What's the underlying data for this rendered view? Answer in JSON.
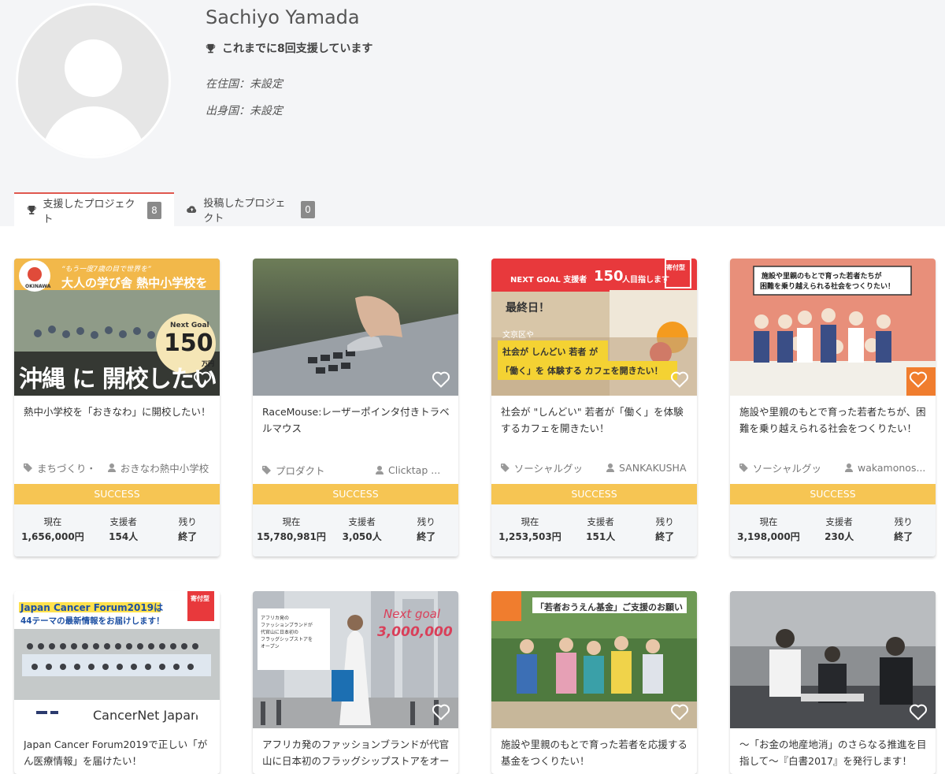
{
  "profile": {
    "name": "Sachiyo Yamada",
    "support_count": "これまでに8回支援しています",
    "residence": "在住国：未設定",
    "origin": "出身国：未設定"
  },
  "tabs": [
    {
      "label": "支援したプロジェクト",
      "count": "8"
    },
    {
      "label": "投稿したプロジェクト",
      "count": "0"
    }
  ],
  "stat_labels": {
    "current": "現在",
    "backers": "支援者",
    "remaining": "残り"
  },
  "thumb_text": {
    "c1": {
      "tagline": "“もう一度7歳の目で世界を”",
      "main": "大人の学び舎 熱中小学校を",
      "goal_label": "Next Goal",
      "goal_value": "150",
      "goal_unit": "万円",
      "banner": "沖縄 に 開校したい",
      "logo": "OKINAWA"
    },
    "c3": {
      "next": "NEXT GOAL  支援者",
      "count": "150",
      "suffix": "人目指します",
      "kifu": "寄付型",
      "last": "最終日！",
      "place": "文京区や",
      "line1": "社会が しんどい 若者 が",
      "line2": "「働く」を 体験する カフェを開きたい！"
    },
    "c4": {
      "bubble1": "施設や里親のもとで育った若者たちが",
      "bubble2": "困難を乗り越えられる社会をつくりたい！"
    },
    "c5": {
      "line1": "Japan Cancer Forum2019は",
      "line2": "44テーマの最新情報をお届けします！",
      "kifu": "寄付型",
      "brand": "CancerNet Japan"
    },
    "c6": {
      "box1": "アフリカ発の",
      "box2": "ファッションブランドが",
      "box3": "代官山に日本初の",
      "box4": "フラッグシップストアを",
      "box5": "オープン",
      "next": "Next goal",
      "amount": "3,000,000"
    },
    "c7": {
      "banner": "「若者おうえん基金」ご支援のお願い"
    }
  },
  "cards": [
    {
      "title": "熱中小学校を「おきなわ」に開校したい！",
      "category": "まちづくり・",
      "owner": "おきなわ熱中小学校",
      "status": "SUCCESS",
      "current": "1,656,000円",
      "backers": "154人",
      "remaining": "終了"
    },
    {
      "title": "RaceMouse:レーザーポインタ付きトラベルマウス",
      "category": "プロダクト",
      "owner": "Clicktap ...",
      "status": "SUCCESS",
      "current": "15,780,981円",
      "backers": "3,050人",
      "remaining": "終了"
    },
    {
      "title": "社会が \"しんどい\" 若者が「働く」を体験するカフェを開きたい！",
      "category": "ソーシャルグッ",
      "owner": "SANKAKUSHA",
      "status": "SUCCESS",
      "current": "1,253,503円",
      "backers": "151人",
      "remaining": "終了"
    },
    {
      "title": "施設や里親のもとで育った若者たちが、困難を乗り越えられる社会をつくりたい！",
      "category": "ソーシャルグッ",
      "owner": "wakamonos...",
      "status": "SUCCESS",
      "current": "3,198,000円",
      "backers": "230人",
      "remaining": "終了"
    },
    {
      "title": "Japan Cancer Forum2019で正しい「がん医療情報」を届けたい！"
    },
    {
      "title": "アフリカ発のファッションブランドが代官山に日本初のフラッグシップストアをオープン"
    },
    {
      "title": "施設や里親のもとで育った若者を応援する基金をつくりたい！"
    },
    {
      "title": "〜「お金の地産地消」のさらなる推進を目指して〜『白書2017』を発行します！"
    }
  ],
  "colors": {
    "success": "#f6c553",
    "accent": "#e0584f",
    "badge": "#8a8a8a"
  }
}
